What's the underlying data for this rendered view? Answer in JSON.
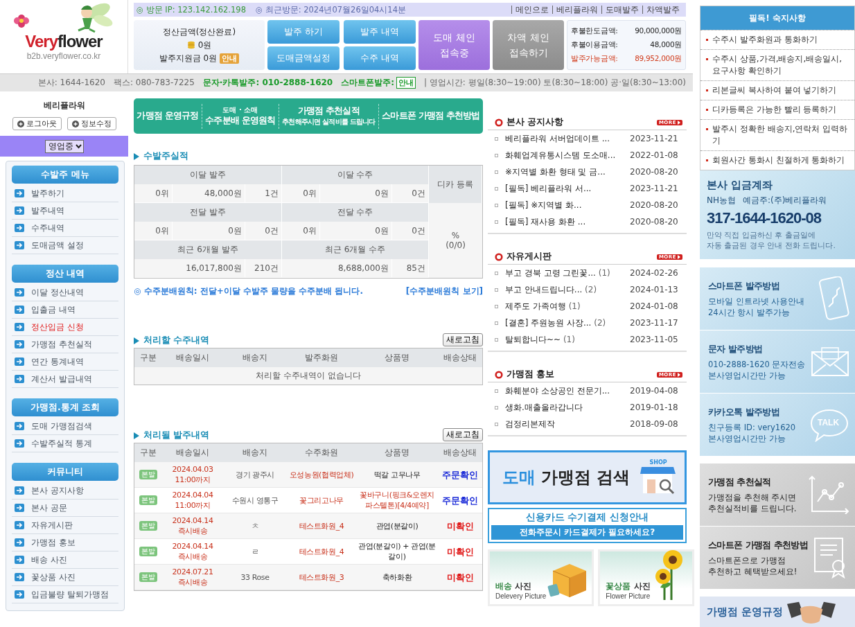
{
  "logo": {
    "first": "Very",
    "second": "flower",
    "url": "b2b.veryflower.co.kr"
  },
  "top_strip": {
    "visit": "◎ 방문 IP: 123.142.162.198",
    "last_visit": "◎ 최근방문: 2024년07월26일04시14분",
    "links": [
      "메인으로",
      "베리플라워",
      "도매발주",
      "차액발주"
    ]
  },
  "summary": {
    "title": "정산금액(정산완료)",
    "amount": "0원",
    "support": "발주지원금 0원",
    "badge": "안내"
  },
  "action_buttons": [
    "발주 하기",
    "발주 내역",
    "도매금액설정",
    "수주 내역"
  ],
  "chain_buttons": [
    {
      "lines": [
        "도매 체인",
        "접속중"
      ],
      "kind": "active"
    },
    {
      "lines": [
        "차액 체인",
        "접속하기"
      ],
      "kind": "inactive"
    }
  ],
  "credit": [
    {
      "label": "후불한도금액:",
      "value": "90,000,000원",
      "highlight": false
    },
    {
      "label": "후불이용금액:",
      "value": "48,000원",
      "highlight": false
    },
    {
      "label": "발주가능금액:",
      "value": "89,952,000원",
      "highlight": true
    }
  ],
  "info_bar": [
    {
      "kind": "plain",
      "text": "본사: 1644-1620"
    },
    {
      "kind": "plain",
      "text": "팩스: 080-783-7225"
    },
    {
      "kind": "green",
      "text": "문자·카톡발주: 010-2888-1620"
    },
    {
      "kind": "badge",
      "text": "스마트폰발주:",
      "badge": "안내"
    },
    {
      "kind": "plain",
      "text": "| 영업시간: 평일(8:30~19:00) 토(8:30~18:00) 공·일(8:30~13:00)"
    }
  ],
  "sidebar": {
    "user": "베리플라워",
    "buttons": [
      "로그아웃",
      "정보수정"
    ],
    "status": "영업중",
    "groups": [
      {
        "title": "수발주 메뉴",
        "items": [
          {
            "label": "발주하기",
            "alert": false
          },
          {
            "label": "발주내역",
            "alert": false
          },
          {
            "label": "수주내역",
            "alert": false
          },
          {
            "label": "도매금액 설정",
            "alert": false
          }
        ]
      },
      {
        "title": "정산 내역",
        "items": [
          {
            "label": "이달 정산내역",
            "alert": false
          },
          {
            "label": "입출금 내역",
            "alert": false
          },
          {
            "label": "정산입금 신청",
            "alert": true
          },
          {
            "label": "가맹점 추천실적",
            "alert": false
          },
          {
            "label": "연간 통계내역",
            "alert": false
          },
          {
            "label": "계산서 발급내역",
            "alert": false
          }
        ]
      },
      {
        "title": "가맹점.통계 조회",
        "items": [
          {
            "label": "도매 가맹점검색",
            "alert": false
          },
          {
            "label": "수발주실적 통계",
            "alert": false
          }
        ]
      },
      {
        "title": "커뮤니티",
        "items": [
          {
            "label": "본사 공지사항",
            "alert": false
          },
          {
            "label": "본사 공문",
            "alert": false
          },
          {
            "label": "자유게시판",
            "alert": false
          },
          {
            "label": "가맹점 홍보",
            "alert": false
          },
          {
            "label": "배송 사진",
            "alert": false
          },
          {
            "label": "꽃상품 사진",
            "alert": false
          },
          {
            "label": "입금불량 탈퇴가맹점",
            "alert": false
          }
        ]
      }
    ]
  },
  "banner": [
    {
      "title": "가맹점 운영규정"
    },
    {
      "kicker": "도매 · 소매",
      "title": "수주분배 운영원칙"
    },
    {
      "title": "가맹점 추천실적",
      "subtitle": "추천해주시면 실적비를 드립니다"
    },
    {
      "title": "스마트폰 가맹점 추천방법"
    }
  ],
  "stats": {
    "title": "수발주실적",
    "side_header": "디카 등록",
    "side_value": [
      "%",
      "(0/0)"
    ],
    "blocks": [
      {
        "headers": [
          "이달 발주",
          "이달 수주"
        ],
        "cells": [
          [
            "0위",
            "48,000원",
            "1건"
          ],
          [
            "0위",
            "0원",
            "0건"
          ]
        ]
      },
      {
        "headers": [
          "전달 발주",
          "전달 수주"
        ],
        "cells": [
          [
            "0위",
            "0원",
            "0건"
          ],
          [
            "0위",
            "0원",
            "0건"
          ]
        ]
      },
      {
        "headers": [
          "최근 6개월 발주",
          "최근 6개월 수주"
        ],
        "cells": [
          [
            "16,017,800원",
            "210건"
          ],
          [
            "8,688,000원",
            "85건"
          ]
        ]
      }
    ],
    "note": "◎ 수주분배원칙: 전달+이달 수발주 물량을 수주분배 됩니다.",
    "link": "[수주분배원칙 보기]"
  },
  "pending": {
    "title": "처리할 수주내역",
    "refresh": "새로고침",
    "columns": [
      "구분",
      "배송일시",
      "배송지",
      "발주화원",
      "상품명",
      "배송상태"
    ],
    "empty": "처리할 수주내역이 없습니다"
  },
  "orders": {
    "title": "처리될 발주내역",
    "refresh": "새로고침",
    "columns": [
      "구분",
      "배송일시",
      "배송지",
      "수주화원",
      "상품명",
      "배송상태"
    ],
    "rows": [
      {
        "tag": "본발",
        "date": "2024.04.03",
        "time": "11:00까지",
        "dest": "경기 광주시",
        "florist": "오성농원(협력업체)",
        "product": "떡갈 고무나무",
        "product_highlight": false,
        "status": "주문확인",
        "color": "#1a2ad8"
      },
      {
        "tag": "본발",
        "date": "2024.04.04",
        "time": "11:00까지",
        "dest": "수원시 영통구",
        "florist": "꽃그리고나무",
        "product": "꽃바구니(핑크&오렌지 파스텔톤)[4/4예약]",
        "product_highlight": true,
        "status": "주문확인",
        "color": "#1a2ad8"
      },
      {
        "tag": "본발",
        "date": "2024.04.14",
        "time": "즉시배송",
        "dest": "ㅊ",
        "florist": "테스트화원_4",
        "product": "관엽(분갈이)",
        "product_highlight": false,
        "status": "미확인",
        "color": "#e01818"
      },
      {
        "tag": "본발",
        "date": "2024.04.14",
        "time": "즉시배송",
        "dest": "ㄹ",
        "florist": "테스트화원_4",
        "product": "관엽(분갈이) + 관엽(분갈이)",
        "product_highlight": false,
        "status": "미확인",
        "color": "#e01818"
      },
      {
        "tag": "본발",
        "date": "2024.07.21",
        "time": "즉시배송",
        "dest": "33 Rose",
        "florist": "테스트화원_3",
        "product": "축하화환",
        "product_highlight": false,
        "status": "미확인",
        "color": "#e01818"
      }
    ]
  },
  "boards": [
    {
      "title": "본사 공지사항",
      "more": "MORE",
      "items": [
        {
          "text": "베리플라워 서버업데이트 ...",
          "date": "2023-11-21"
        },
        {
          "text": "화훼업계유통시스템 도소매...",
          "date": "2022-01-08"
        },
        {
          "text": "※지역별 화환 형태 및 금...",
          "date": "2020-08-20"
        },
        {
          "text": "[필독] 베리플라워 서...",
          "date": "2023-11-21"
        },
        {
          "text": "[필독] ※지역별 화...",
          "date": "2020-08-20"
        },
        {
          "text": "[필독] 재사용 화환 ...",
          "date": "2020-08-20"
        }
      ]
    },
    {
      "title": "자유게시판",
      "more": "MORE",
      "items": [
        {
          "text": "부고 경북 고령 그린꽃...",
          "comments": "(1)",
          "date": "2024-02-26"
        },
        {
          "text": "부고 안내드립니다...",
          "comments": "(2)",
          "date": "2024-01-13"
        },
        {
          "text": "제주도 가족여행",
          "comments": "(1)",
          "date": "2024-01-08"
        },
        {
          "text": "[결혼] 주원농원 사장...",
          "comments": "(2)",
          "date": "2023-11-17"
        },
        {
          "text": "탈퇴합니다~~",
          "comments": "(1)",
          "date": "2023-11-05"
        }
      ]
    },
    {
      "title": "가맹점 홍보",
      "more": "MORE",
      "items": [
        {
          "text": "화훼분야 소상공인 전문기...",
          "date": "2019-04-08"
        },
        {
          "text": "생화.매출올라갑니다",
          "date": "2019-01-18"
        },
        {
          "text": "검정리본제작",
          "date": "2018-09-08"
        }
      ]
    }
  ],
  "search_banner": {
    "accent": "도매",
    "title": "가맹점 검색",
    "shop": "SHOP"
  },
  "card_banner": {
    "title": "신용카드 수기결제 신청안내",
    "subtitle": "전화주문시 카드결제가 필요하세요?"
  },
  "photo_tiles": [
    {
      "accent": "배송",
      "title": "사진",
      "caption": "Delevery Picture",
      "kind": "box"
    },
    {
      "accent": "꽃상품",
      "title": "사진",
      "caption": "Flower Picture",
      "kind": "sunflower"
    }
  ],
  "must_know": {
    "title": "필독! 숙지사항",
    "items": [
      "수주시 발주화원과 통화하기",
      "수주시 상품,가격,배송지,배송일시, 요구사항 확인하기",
      "리본글씨 복사하여 붙여 넣기하기",
      "디카등록은 가능한 빨리 등록하기",
      "발주시 정확한 배송지,연락처 입력하기",
      "회원사간 통화시 친절하게 통화하기"
    ]
  },
  "account": {
    "title": "본사 입금계좌",
    "bank": "NH농협",
    "holder": "예금주:(주)베리플라워",
    "number": "317-1644-1620-08",
    "note": [
      "만약 직접 입금하신 후 출금일에",
      "자동 출금된 경우 안내 전화 드립니다."
    ]
  },
  "methods": [
    {
      "kind": "phone",
      "title": "스마트폰 발주방법",
      "lines": [
        "모바일 인트라넷 사용안내",
        "24시간 항시 발주가능"
      ]
    },
    {
      "kind": "mail",
      "title": "문자 발주방법",
      "lines": [
        "010-2888-1620 문자전송",
        "본사영업시간만 가능"
      ]
    },
    {
      "kind": "talk",
      "title": "카카오톡 발주방법",
      "lines": [
        "친구등록 ID: very1620",
        "본사영업시간만 가능"
      ],
      "badge": "TALK"
    }
  ],
  "promos": [
    {
      "kind": "chart",
      "title": "가맹점 추천실적",
      "lines": [
        "가맹점을 추천해 주시면",
        "추천실적비를 드립니다."
      ]
    },
    {
      "kind": "certificate",
      "title": "스마트폰 가맹점 추천방법",
      "lines": [
        "스마트폰으로 가맹점",
        "추천하고 혜택받으세요!"
      ]
    }
  ],
  "rules_banner": {
    "title": "가맹점 운영규정"
  }
}
